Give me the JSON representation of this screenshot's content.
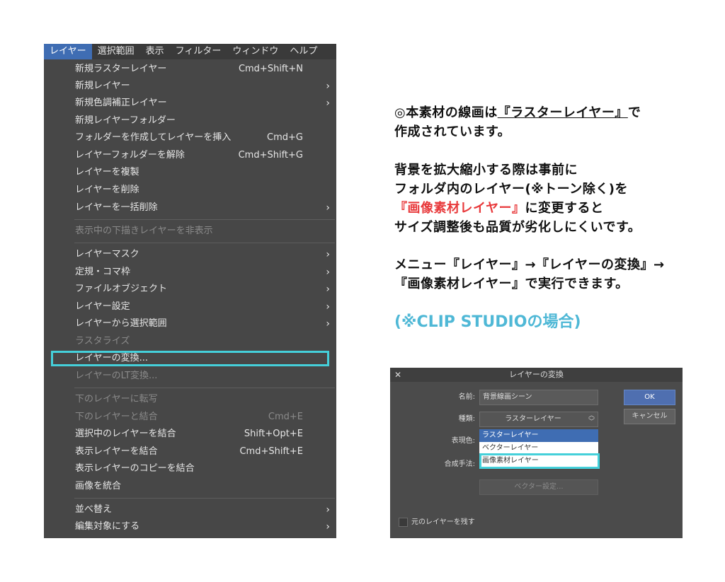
{
  "menu": {
    "menubar": [
      "レイヤー",
      "選択範囲",
      "表示",
      "フィルター",
      "ウィンドウ",
      "ヘルプ"
    ],
    "items": [
      {
        "label": "新規ラスターレイヤー",
        "shortcut": "Cmd+Shift+N",
        "submenu": false,
        "disabled": false
      },
      {
        "label": "新規レイヤー",
        "shortcut": "",
        "submenu": true,
        "disabled": false
      },
      {
        "label": "新規色調補正レイヤー",
        "shortcut": "",
        "submenu": true,
        "disabled": false
      },
      {
        "label": "新規レイヤーフォルダー",
        "shortcut": "",
        "submenu": false,
        "disabled": false
      },
      {
        "label": "フォルダーを作成してレイヤーを挿入",
        "shortcut": "Cmd+G",
        "submenu": false,
        "disabled": false
      },
      {
        "label": "レイヤーフォルダーを解除",
        "shortcut": "Cmd+Shift+G",
        "submenu": false,
        "disabled": false
      },
      {
        "label": "レイヤーを複製",
        "shortcut": "",
        "submenu": false,
        "disabled": false
      },
      {
        "label": "レイヤーを削除",
        "shortcut": "",
        "submenu": false,
        "disabled": false
      },
      {
        "label": "レイヤーを一括削除",
        "shortcut": "",
        "submenu": true,
        "disabled": false
      },
      {
        "label": "表示中の下描きレイヤーを非表示",
        "shortcut": "",
        "submenu": false,
        "disabled": true
      },
      {
        "label": "レイヤーマスク",
        "shortcut": "",
        "submenu": true,
        "disabled": false
      },
      {
        "label": "定規・コマ枠",
        "shortcut": "",
        "submenu": true,
        "disabled": false
      },
      {
        "label": "ファイルオブジェクト",
        "shortcut": "",
        "submenu": true,
        "disabled": false
      },
      {
        "label": "レイヤー設定",
        "shortcut": "",
        "submenu": true,
        "disabled": false
      },
      {
        "label": "レイヤーから選択範囲",
        "shortcut": "",
        "submenu": true,
        "disabled": false
      },
      {
        "label": "ラスタライズ",
        "shortcut": "",
        "submenu": false,
        "disabled": true
      },
      {
        "label": "レイヤーの変換...",
        "shortcut": "",
        "submenu": false,
        "disabled": false,
        "highlighted": true
      },
      {
        "label": "レイヤーのLT変換...",
        "shortcut": "",
        "submenu": false,
        "disabled": true
      },
      {
        "label": "下のレイヤーに転写",
        "shortcut": "",
        "submenu": false,
        "disabled": true
      },
      {
        "label": "下のレイヤーと結合",
        "shortcut": "Cmd+E",
        "submenu": false,
        "disabled": true
      },
      {
        "label": "選択中のレイヤーを結合",
        "shortcut": "Shift+Opt+E",
        "submenu": false,
        "disabled": false
      },
      {
        "label": "表示レイヤーを結合",
        "shortcut": "Cmd+Shift+E",
        "submenu": false,
        "disabled": false
      },
      {
        "label": "表示レイヤーのコピーを結合",
        "shortcut": "",
        "submenu": false,
        "disabled": false
      },
      {
        "label": "画像を統合",
        "shortcut": "",
        "submenu": false,
        "disabled": false
      },
      {
        "label": "並べ替え",
        "shortcut": "",
        "submenu": true,
        "disabled": false
      },
      {
        "label": "編集対象にする",
        "shortcut": "",
        "submenu": true,
        "disabled": false
      }
    ]
  },
  "note": {
    "l1a": "◎本素材の線画は",
    "l1b": "『ラスターレイヤー』",
    "l1c": "で",
    "l2": "作成されています。",
    "l3": "背景を拡大縮小する際は事前に",
    "l4": "フォルダ内のレイヤー(※トーン除く)を",
    "l5a": "『画像素材レイヤー』",
    "l5b": "に変更すると",
    "l6": "サイズ調整後も品質が劣化しにくいです。",
    "l7": "メニュー『レイヤー』→『レイヤーの変換』→",
    "l8": "『画像素材レイヤー』で実行できます。",
    "l9": "(※CLIP STUDIOの場合)"
  },
  "dialog": {
    "title": "レイヤーの変換",
    "close": "✕",
    "name_label": "名前:",
    "name_value": "背景線画シーン",
    "type_label": "種類:",
    "type_value": "ラスターレイヤー",
    "color_label": "表現色:",
    "blend_label": "合成手法:",
    "options": [
      "ラスターレイヤー",
      "ベクターレイヤー",
      "画像素材レイヤー"
    ],
    "vector_btn": "ベクター設定...",
    "ok": "OK",
    "cancel": "キャンセル",
    "keep_original": "元のレイヤーを残す"
  },
  "colors": {
    "highlight": "#45d0da",
    "menu_bg": "#474747",
    "accent_blue": "#3f6db3",
    "note_red": "#e8393b",
    "note_blue": "#4fb8d6"
  }
}
